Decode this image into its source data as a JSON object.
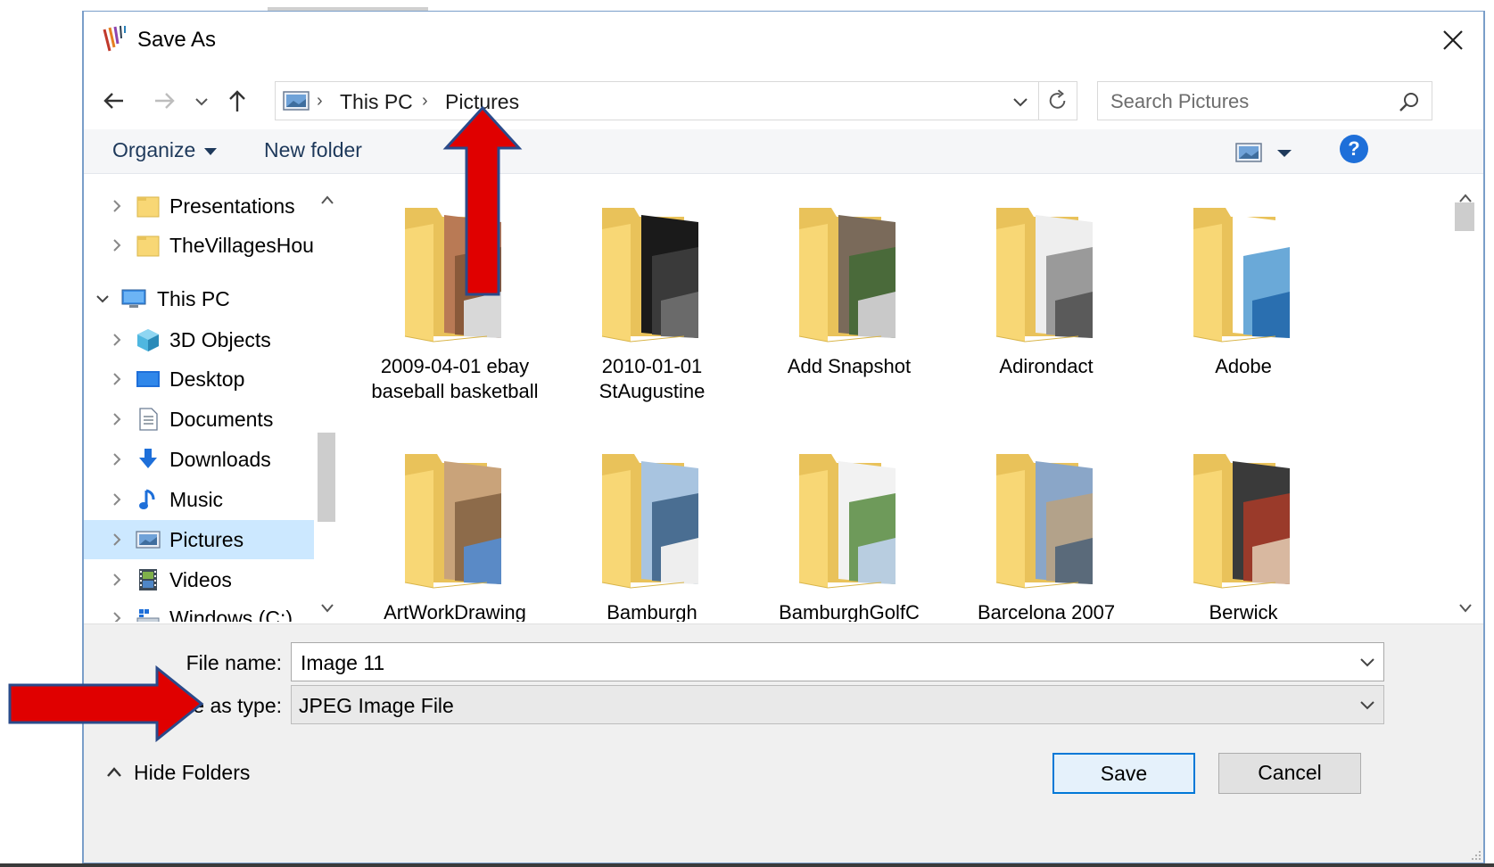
{
  "dialog": {
    "title": "Save As"
  },
  "nav": {
    "back_label": "Back",
    "forward_label": "Forward",
    "recent_label": "Recent locations",
    "up_label": "Up"
  },
  "address": {
    "breadcrumbs": [
      "This PC",
      "Pictures"
    ]
  },
  "search": {
    "placeholder": "Search Pictures"
  },
  "toolbar": {
    "organize_label": "Organize",
    "new_folder_label": "New folder",
    "help_label": "?"
  },
  "tree": {
    "items": [
      {
        "label": "Presentations",
        "icon": "folder-icon"
      },
      {
        "label": "TheVillagesHous",
        "icon": "folder-icon"
      },
      {
        "label": "This PC",
        "icon": "computer-icon"
      },
      {
        "label": "3D Objects",
        "icon": "3d-objects-icon"
      },
      {
        "label": "Desktop",
        "icon": "desktop-icon"
      },
      {
        "label": "Documents",
        "icon": "documents-icon"
      },
      {
        "label": "Downloads",
        "icon": "downloads-icon"
      },
      {
        "label": "Music",
        "icon": "music-icon"
      },
      {
        "label": "Pictures",
        "icon": "pictures-icon",
        "selected": true
      },
      {
        "label": "Videos",
        "icon": "videos-icon"
      },
      {
        "label": "Windows (C:)",
        "icon": "drive-icon"
      }
    ]
  },
  "folders": [
    {
      "name": "2009-04-01 ebay baseball basketball"
    },
    {
      "name": "2010-01-01 StAugustine"
    },
    {
      "name": "Add Snapshot"
    },
    {
      "name": "Adirondact"
    },
    {
      "name": "Adobe"
    },
    {
      "name": "ArtWorkDrawing"
    },
    {
      "name": "Bamburgh"
    },
    {
      "name": "BamburghGolfC"
    },
    {
      "name": "Barcelona 2007"
    },
    {
      "name": "Berwick"
    }
  ],
  "form": {
    "file_name_label": "File name:",
    "file_name_value": "Image 11",
    "save_type_label": "Save as type:",
    "save_type_value": "JPEG Image File"
  },
  "footer": {
    "hide_folders_label": "Hide Folders",
    "save_label": "Save",
    "cancel_label": "Cancel"
  },
  "colors": {
    "accent": "#0078d7",
    "selection": "#cce8ff",
    "annotation_arrow": "#e00000",
    "folder_yellow": "#f8d775"
  }
}
